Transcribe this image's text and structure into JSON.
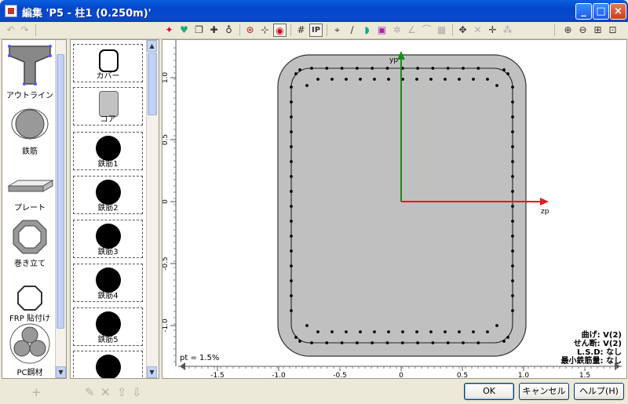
{
  "window": {
    "title": "編集 'P5 - 柱1 (0.250m)'",
    "min": "_",
    "max": "□",
    "close": "×"
  },
  "palette": {
    "items": [
      {
        "label": "アウトライン"
      },
      {
        "label": "鉄筋"
      },
      {
        "label": "プレート"
      },
      {
        "label": "巻き立て"
      },
      {
        "label": "FRP 貼付け"
      },
      {
        "label": "PC鋼材"
      }
    ]
  },
  "materials": {
    "items": [
      {
        "label": "カバー"
      },
      {
        "label": "コア"
      },
      {
        "label": "鉄筋1"
      },
      {
        "label": "鉄筋2"
      },
      {
        "label": "鉄筋3"
      },
      {
        "label": "鉄筋4"
      },
      {
        "label": "鉄筋5"
      },
      {
        "label": ""
      }
    ]
  },
  "canvas": {
    "axis_y_label": "yp",
    "axis_z_label": "zp",
    "vertical_ticks": [
      "1.0",
      "0.5",
      "0",
      "-0.5",
      "-1.0"
    ],
    "horizontal_ticks": [
      "-1.5",
      "-1.0",
      "-0.5",
      "0",
      "0.5",
      "1.0",
      "1.5"
    ],
    "pt_label": "pt = 1.5%",
    "legend": [
      "曲げ: V(2)",
      "せん断: V(2)",
      "L.S.D: なし",
      "最小鉄筋量: なし"
    ]
  },
  "buttons": {
    "ok": "OK",
    "cancel": "キャンセル",
    "help": "ヘルプ(H)"
  },
  "colors": {
    "y_axis": "#1a8a1a",
    "z_axis": "#e01b1b",
    "section_fill": "#c0c0c0"
  }
}
